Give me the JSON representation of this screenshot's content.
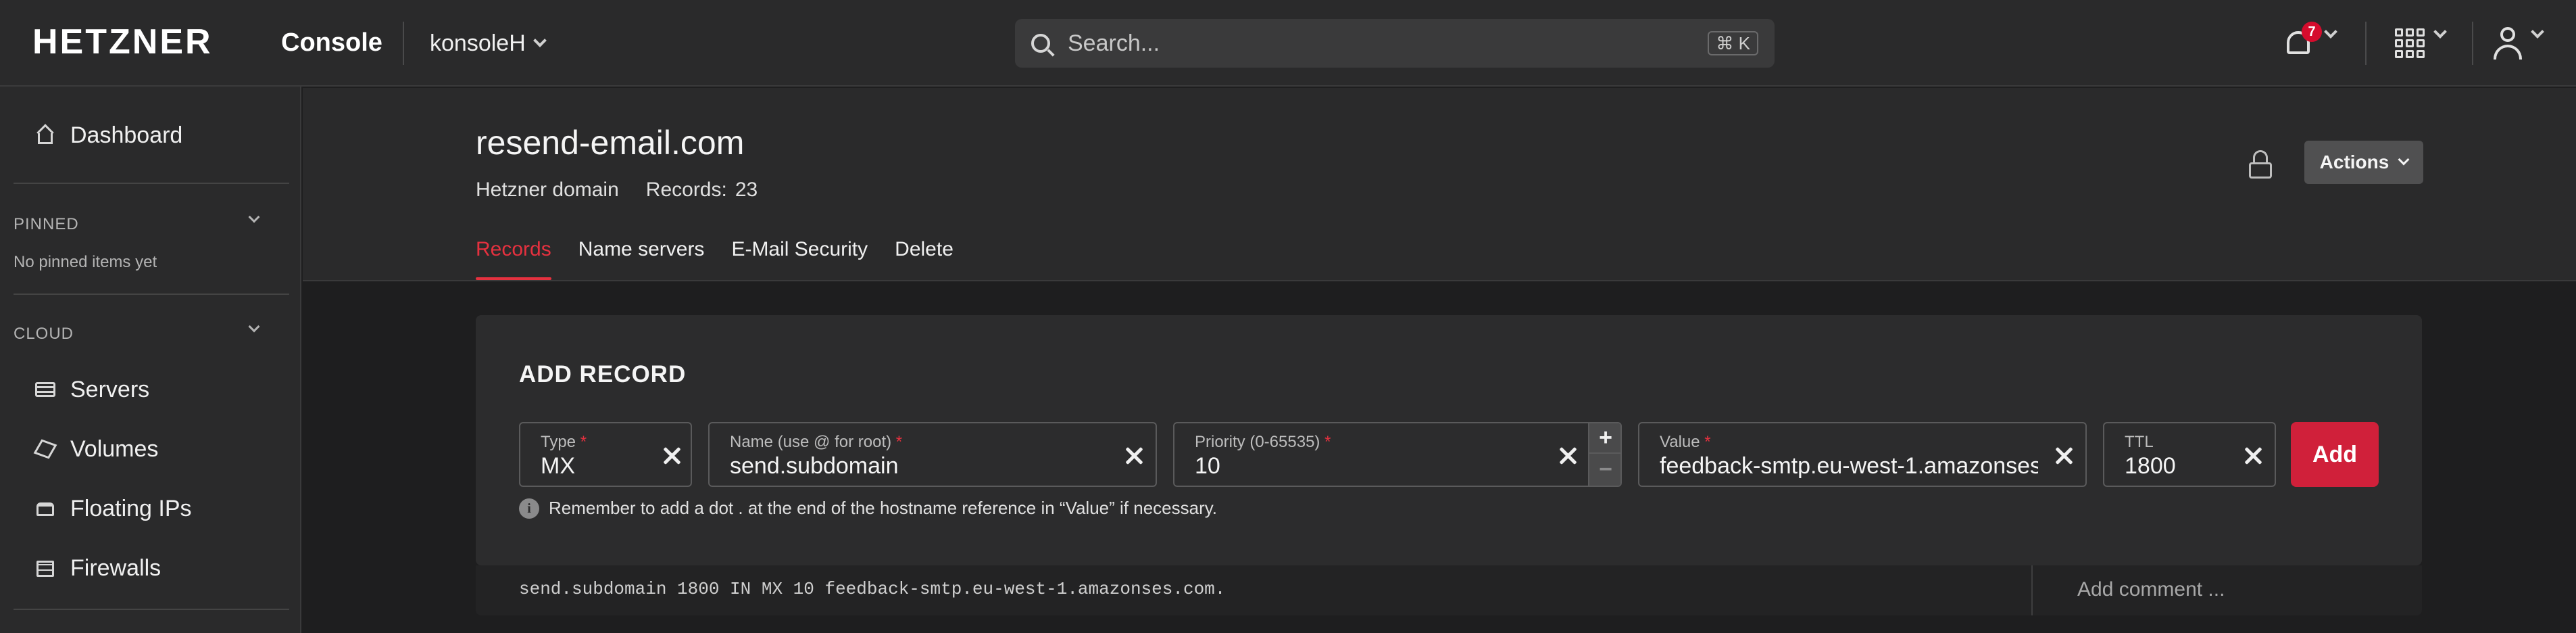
{
  "topbar": {
    "logo": "HETZNER",
    "product": "Console",
    "project": "konsoleH",
    "search_placeholder": "Search...",
    "search_shortcut": "⌘ K",
    "notifications_count": "7"
  },
  "sidebar": {
    "dashboard": "Dashboard",
    "pinned_title": "PINNED",
    "pinned_empty": "No pinned items yet",
    "cloud_title": "CLOUD",
    "items": [
      {
        "label": "Servers",
        "icon": "server-icon"
      },
      {
        "label": "Volumes",
        "icon": "cube-icon"
      },
      {
        "label": "Floating IPs",
        "icon": "floating-ip-icon"
      },
      {
        "label": "Firewalls",
        "icon": "firewall-icon"
      }
    ]
  },
  "header": {
    "domain": "resend-email.com",
    "domain_type": "Hetzner domain",
    "records_label": "Records:",
    "records_count": "23",
    "actions_label": "Actions",
    "tabs": [
      "Records",
      "Name servers",
      "E-Mail Security",
      "Delete"
    ],
    "active_tab": "Records"
  },
  "add_record": {
    "title": "ADD RECORD",
    "type": {
      "label": "Type",
      "value": "MX"
    },
    "name": {
      "label": "Name (use @ for root)",
      "value": "send.subdomain"
    },
    "priority": {
      "label": "Priority (0-65535)",
      "value": "10"
    },
    "value": {
      "label": "Value",
      "value": "feedback-smtp.eu-west-1.amazonses.com."
    },
    "ttl": {
      "label": "TTL",
      "value": "1800"
    },
    "add_label": "Add",
    "hint": "Remember to add a dot . at the end of the hostname reference in “Value” if necessary."
  },
  "record": {
    "text": "send.subdomain 1800 IN MX 10 feedback-smtp.eu-west-1.amazonses.com.",
    "comment_placeholder": "Add comment ..."
  },
  "colors": {
    "accent": "#d50c2d",
    "background": "#1e1e1f",
    "surface": "#2a2a2b"
  }
}
